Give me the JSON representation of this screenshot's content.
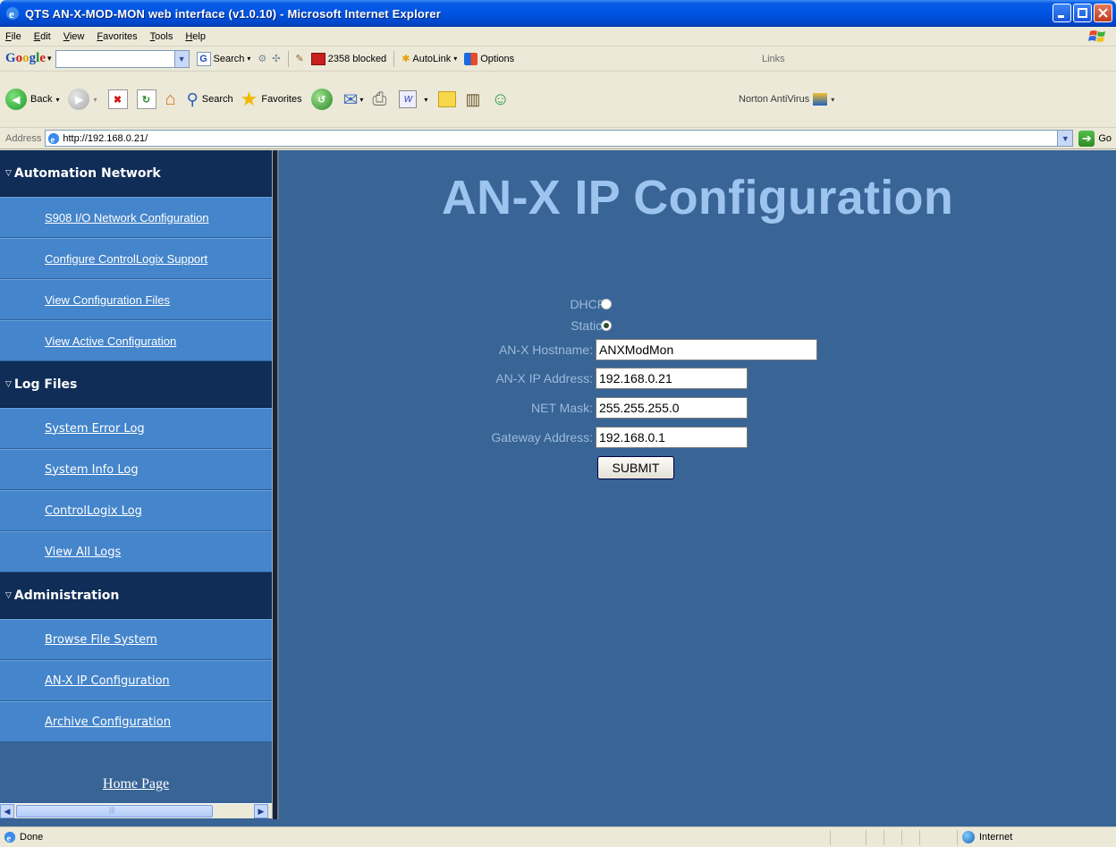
{
  "window": {
    "title": "QTS AN-X-MOD-MON web interface (v1.0.10) - Microsoft Internet Explorer"
  },
  "menu": [
    "File",
    "Edit",
    "View",
    "Favorites",
    "Tools",
    "Help"
  ],
  "google_toolbar": {
    "logo": "Google",
    "search_label": "Search",
    "blocked_label": "2358 blocked",
    "autolink_label": "AutoLink",
    "options_label": "Options",
    "links_label": "Links"
  },
  "std_toolbar": {
    "back_label": "Back",
    "search_label": "Search",
    "favorites_label": "Favorites",
    "norton_label": "Norton AntiVirus"
  },
  "address_bar": {
    "label": "Address",
    "url": "http://192.168.0.21/",
    "go_label": "Go"
  },
  "sidebar": {
    "sections": [
      {
        "title": "Automation Network",
        "items": [
          "S908 I/O Network Configuration",
          "Configure ControlLogix Support",
          "View Configuration Files",
          "View Active Configuration"
        ]
      },
      {
        "title": "Log Files",
        "items": [
          "System Error Log",
          "System Info Log",
          "ControlLogix Log",
          "View All Logs"
        ]
      },
      {
        "title": "Administration",
        "items": [
          "Browse File System",
          "AN-X IP Configuration",
          "Archive Configuration"
        ]
      }
    ],
    "home_link": "Home Page"
  },
  "page": {
    "title": "AN-X IP Configuration",
    "dhcp_label": "DHCP:",
    "static_label": "Static :",
    "selected_mode": "Static",
    "hostname_label": "AN-X Hostname:",
    "hostname_value": "ANXModMon",
    "ip_label": "AN-X IP Address:",
    "ip_value": "192.168.0.21",
    "netmask_label": "NET Mask:",
    "netmask_value": "255.255.255.0",
    "gateway_label": "Gateway Address:",
    "gateway_value": "192.168.0.1",
    "submit_label": "SUBMIT"
  },
  "status_bar": {
    "status": "Done",
    "zone": "Internet"
  }
}
